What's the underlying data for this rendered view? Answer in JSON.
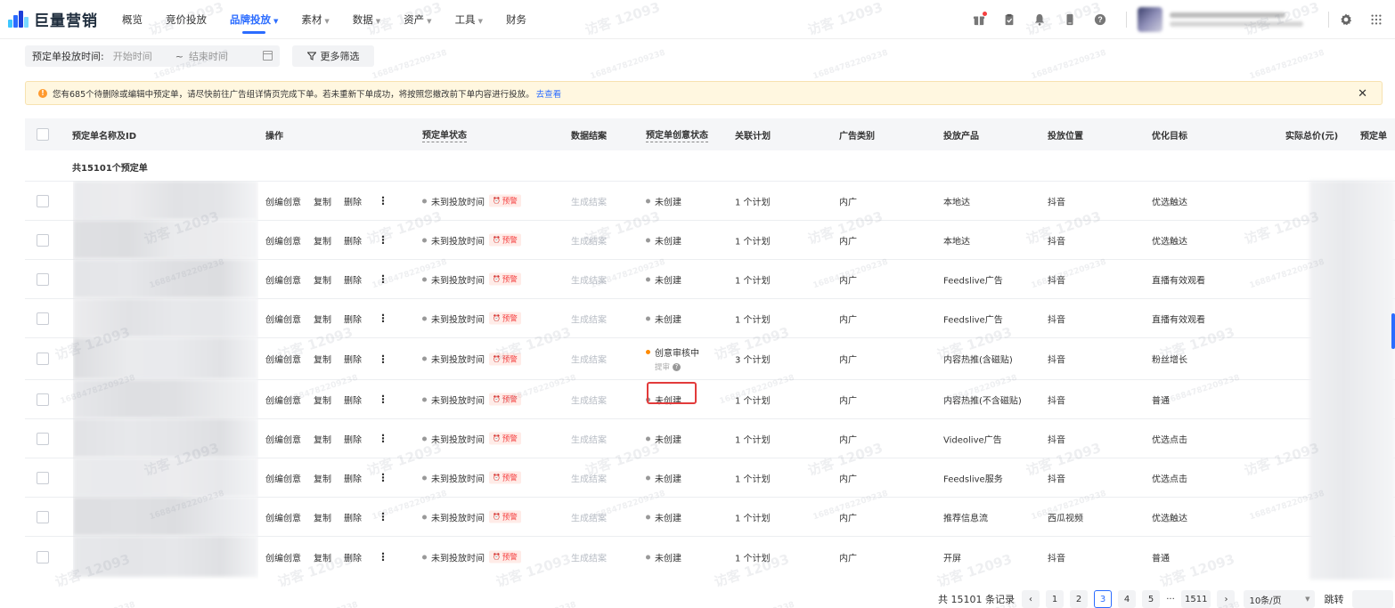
{
  "brand": {
    "name": "巨量营销"
  },
  "nav": [
    {
      "label": "概览",
      "caret": false,
      "active": false
    },
    {
      "label": "竞价投放",
      "caret": false,
      "active": false
    },
    {
      "label": "品牌投放",
      "caret": true,
      "active": true
    },
    {
      "label": "素材",
      "caret": true,
      "active": false
    },
    {
      "label": "数据",
      "caret": true,
      "active": false
    },
    {
      "label": "资产",
      "caret": true,
      "active": false
    },
    {
      "label": "工具",
      "caret": true,
      "active": false
    },
    {
      "label": "财务",
      "caret": false,
      "active": false
    }
  ],
  "nav_icons": [
    "gift-icon",
    "clipboard-icon",
    "bell-icon",
    "mobile-icon",
    "help-icon",
    "settings-icon",
    "app-grid-icon"
  ],
  "filters": {
    "date_label": "预定单投放时间:",
    "start_placeholder": "开始时间",
    "separator": "~",
    "end_placeholder": "结束时间",
    "more_filters": "更多筛选"
  },
  "notice": {
    "text": "您有685个待删除或编辑中预定单，请尽快前往广告组详情页完成下单。若未重新下单成功，将按照您撤改前下单内容进行投放。",
    "link": "去查看"
  },
  "table": {
    "headers": {
      "name": "预定单名称及ID",
      "ops": "操作",
      "status": "预定单状态",
      "report": "数据结案",
      "creative_status": "预定单创意状态",
      "plan": "关联计划",
      "ad_type": "广告类别",
      "product": "投放产品",
      "position": "投放位置",
      "goal": "优化目标",
      "total": "实际总价(元)",
      "more": "预定单"
    },
    "count_text": "共15101个预定单",
    "op_labels": {
      "edit_creative": "创编创意",
      "copy": "复制",
      "delete": "删除",
      "more": "⋮"
    },
    "warning_badge": "预警",
    "rows": [
      {
        "status": "未到投放时间",
        "report": "生成结案",
        "creative": "未创建",
        "creative_review": false,
        "plan": "1 个计划",
        "ad_type": "内广",
        "product": "本地达",
        "position": "抖音",
        "goal": "优选触达"
      },
      {
        "status": "未到投放时间",
        "report": "生成结案",
        "creative": "未创建",
        "creative_review": false,
        "plan": "1 个计划",
        "ad_type": "内广",
        "product": "本地达",
        "position": "抖音",
        "goal": "优选触达"
      },
      {
        "status": "未到投放时间",
        "report": "生成结案",
        "creative": "未创建",
        "creative_review": false,
        "plan": "1 个计划",
        "ad_type": "内广",
        "product": "Feedslive广告",
        "position": "抖音",
        "goal": "直播有效观看"
      },
      {
        "status": "未到投放时间",
        "report": "生成结案",
        "creative": "未创建",
        "creative_review": false,
        "plan": "1 个计划",
        "ad_type": "内广",
        "product": "Feedslive广告",
        "position": "抖音",
        "goal": "直播有效观看"
      },
      {
        "status": "未到投放时间",
        "report": "生成结案",
        "creative": "创意审核中",
        "creative_sub": "提审",
        "creative_review": true,
        "plan": "3 个计划",
        "ad_type": "内广",
        "product": "内容热推(含磁贴)",
        "position": "抖音",
        "goal": "粉丝增长"
      },
      {
        "status": "未到投放时间",
        "report": "生成结案",
        "creative": "未创建",
        "creative_review": false,
        "plan": "1 个计划",
        "ad_type": "内广",
        "product": "内容热推(不含磁贴)",
        "position": "抖音",
        "goal": "普通"
      },
      {
        "status": "未到投放时间",
        "report": "生成结案",
        "creative": "未创建",
        "creative_review": false,
        "plan": "1 个计划",
        "ad_type": "内广",
        "product": "Videolive广告",
        "position": "抖音",
        "goal": "优选点击"
      },
      {
        "status": "未到投放时间",
        "report": "生成结案",
        "creative": "未创建",
        "creative_review": false,
        "plan": "1 个计划",
        "ad_type": "内广",
        "product": "Feedslive服务",
        "position": "抖音",
        "goal": "优选点击"
      },
      {
        "status": "未到投放时间",
        "report": "生成结案",
        "creative": "未创建",
        "creative_review": false,
        "plan": "1 个计划",
        "ad_type": "内广",
        "product": "推荐信息流",
        "position": "西瓜视频",
        "goal": "优选触达"
      },
      {
        "status": "未到投放时间",
        "report": "生成结案",
        "creative": "未创建",
        "creative_review": false,
        "plan": "1 个计划",
        "ad_type": "内广",
        "product": "开屏",
        "position": "抖音",
        "goal": "普通"
      }
    ]
  },
  "pagination": {
    "total_text": "共 15101 条记录",
    "prev": "‹",
    "pages": [
      "1",
      "2",
      "3",
      "4",
      "5"
    ],
    "active_page": "3",
    "ellipsis": "···",
    "last_page": "1511",
    "next": "›",
    "page_size": "10条/页",
    "jump_label": "跳转"
  },
  "watermark": {
    "text": "访客 12093",
    "number": "16884782209238"
  },
  "colors": {
    "accent": "#2b6cff",
    "warning_bg": "#fff7e0",
    "danger": "#f53f3f",
    "review_orange": "#ff8a00"
  }
}
